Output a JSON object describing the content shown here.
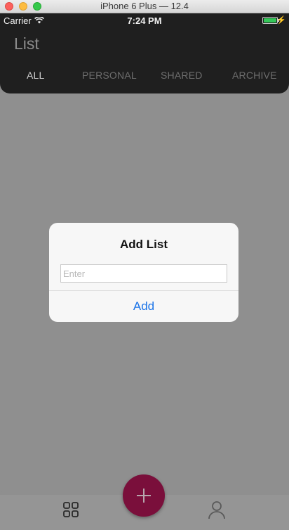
{
  "window": {
    "title": "iPhone 6 Plus — 12.4"
  },
  "status_bar": {
    "carrier": "Carrier",
    "time": "7:24 PM",
    "battery_color": "#35c759"
  },
  "header": {
    "title": "List",
    "tabs": [
      {
        "label": "ALL",
        "active": true
      },
      {
        "label": "PERSONAL",
        "active": false
      },
      {
        "label": "SHARED",
        "active": false
      },
      {
        "label": "ARCHIVE",
        "active": false
      }
    ]
  },
  "dialog": {
    "title": "Add List",
    "input_placeholder": "Enter",
    "input_value": "",
    "action_label": "Add",
    "action_color": "#1a73e8"
  },
  "bottom_nav": {
    "left_icon": "grid-icon",
    "center_button_icon": "plus-icon",
    "center_button_color": "#7a0f3b",
    "right_icon": "user-icon"
  }
}
